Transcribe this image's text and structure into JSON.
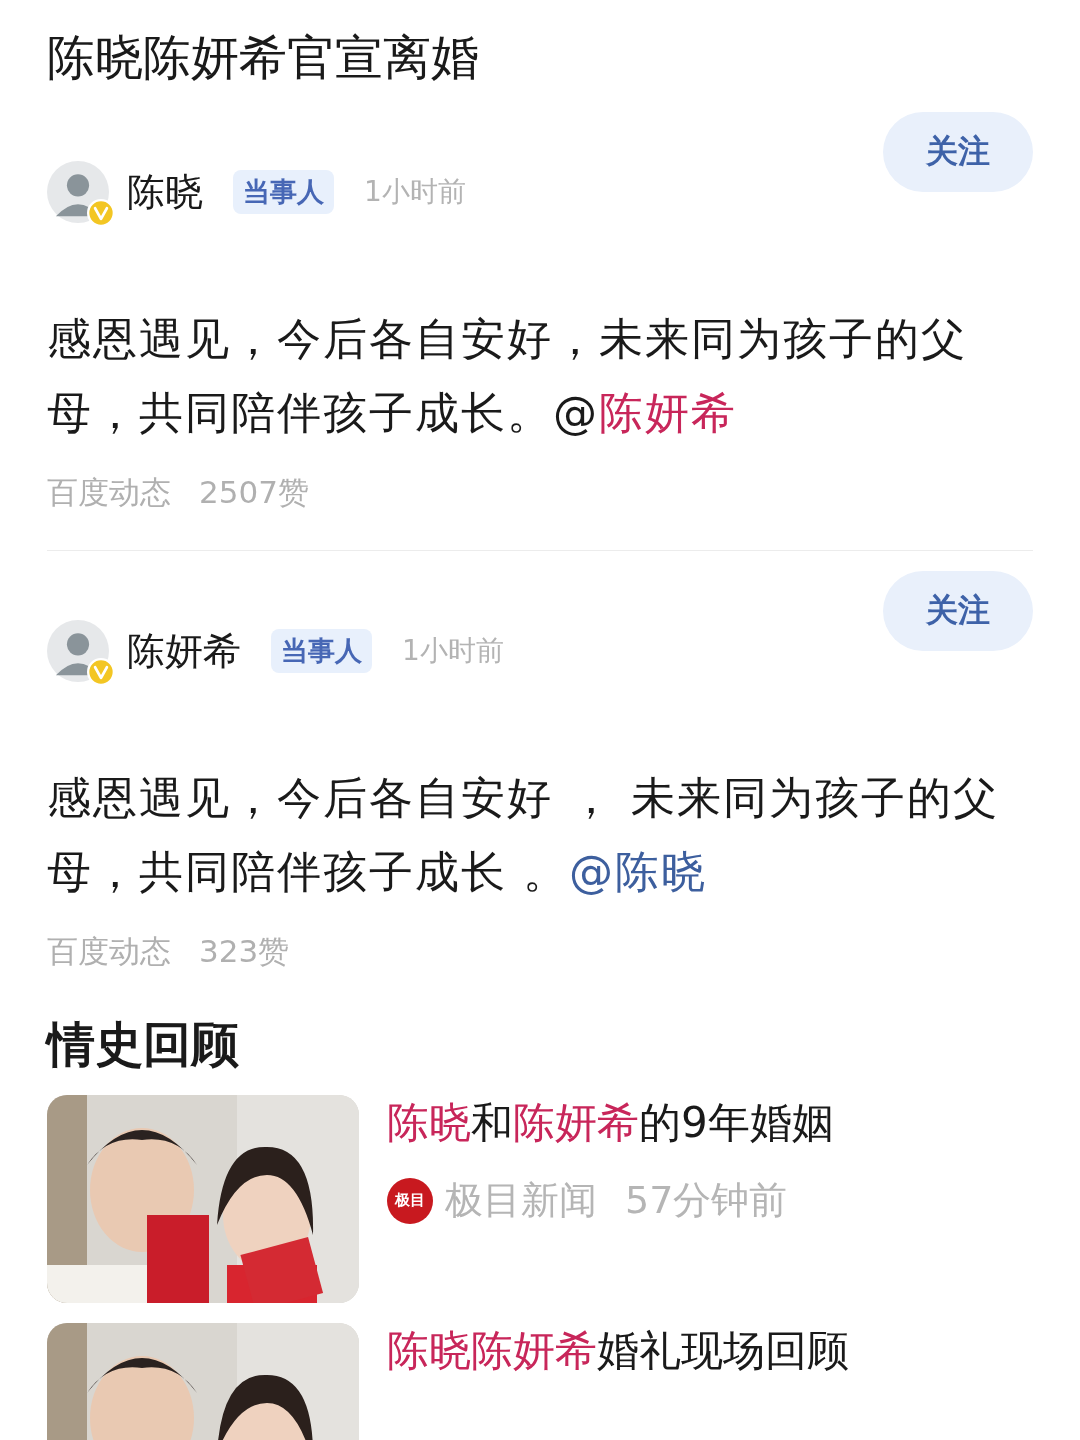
{
  "title": "陈晓陈妍希官宣离婚",
  "posts": [
    {
      "author": "陈晓",
      "tag": "当事人",
      "time": "1小时前",
      "follow": "关注",
      "verified": true,
      "text": "感恩遇见，今后各自安好，未来同为孩子的父母，共同陪伴孩子成长。",
      "mention": {
        "at": "@",
        "name": "陈妍希",
        "color": "#c8265a"
      },
      "source": "百度动态",
      "likes": "2507赞"
    },
    {
      "author": "陈妍希",
      "tag": "当事人",
      "time": "1小时前",
      "follow": "关注",
      "verified": true,
      "text": "感恩遇见，今后各自安好 ， 未来同为孩子的父母，共同陪伴孩子成长 。",
      "mention": {
        "name": "@陈晓",
        "color": "#3d5f9e"
      },
      "source": "百度动态",
      "likes": "323赞"
    }
  ],
  "section_title": "情史回顾",
  "related": [
    {
      "title": [
        {
          "text": "陈晓",
          "highlight": true
        },
        {
          "text": "和",
          "highlight": false
        },
        {
          "text": "陈妍希",
          "highlight": true
        },
        {
          "text": "的9年婚姻",
          "highlight": false
        }
      ],
      "source_logo": "极目",
      "source": "极目新闻",
      "time": "57分钟前"
    },
    {
      "title": [
        {
          "text": "陈晓陈妍希",
          "highlight": true
        },
        {
          "text": "婚礼现场回顾",
          "highlight": false
        }
      ]
    }
  ]
}
